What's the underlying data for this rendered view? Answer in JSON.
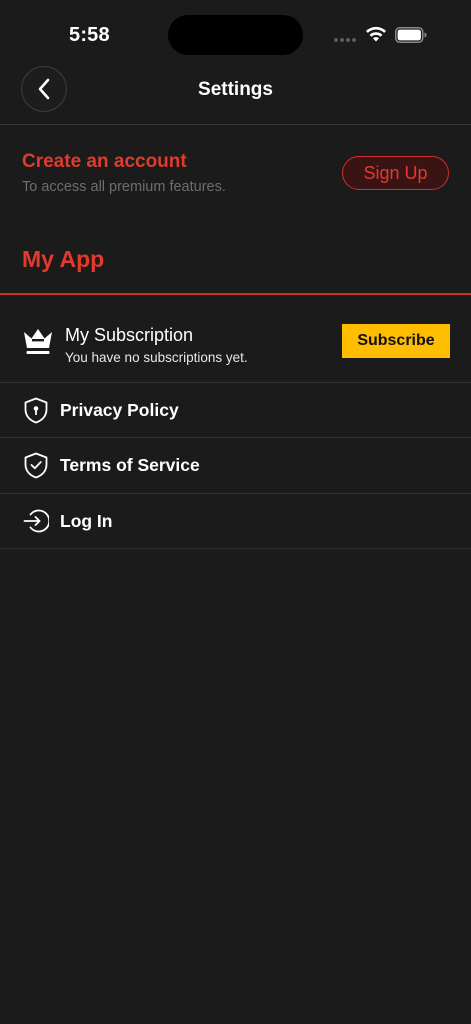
{
  "status_bar": {
    "time": "5:58"
  },
  "header": {
    "title": "Settings",
    "back_icon": "chevron-left-icon"
  },
  "account_promo": {
    "title": "Create an account",
    "subtitle": "To access all premium features.",
    "signup_label": "Sign Up"
  },
  "section": {
    "title": "My App"
  },
  "subscription": {
    "icon": "crown-icon",
    "title": "My Subscription",
    "description": "You have no subscriptions yet.",
    "button_label": "Subscribe"
  },
  "menu": {
    "items": [
      {
        "label": "Privacy Policy",
        "icon": "shield-keyhole-icon"
      },
      {
        "label": "Terms of Service",
        "icon": "shield-check-icon"
      },
      {
        "label": "Log In",
        "icon": "login-icon"
      }
    ]
  },
  "colors": {
    "background": "#1b1b1b",
    "accent_red": "#e23a2c",
    "subscribe_yellow": "#ffbd00",
    "subtext_gray": "#6e6e6e"
  }
}
